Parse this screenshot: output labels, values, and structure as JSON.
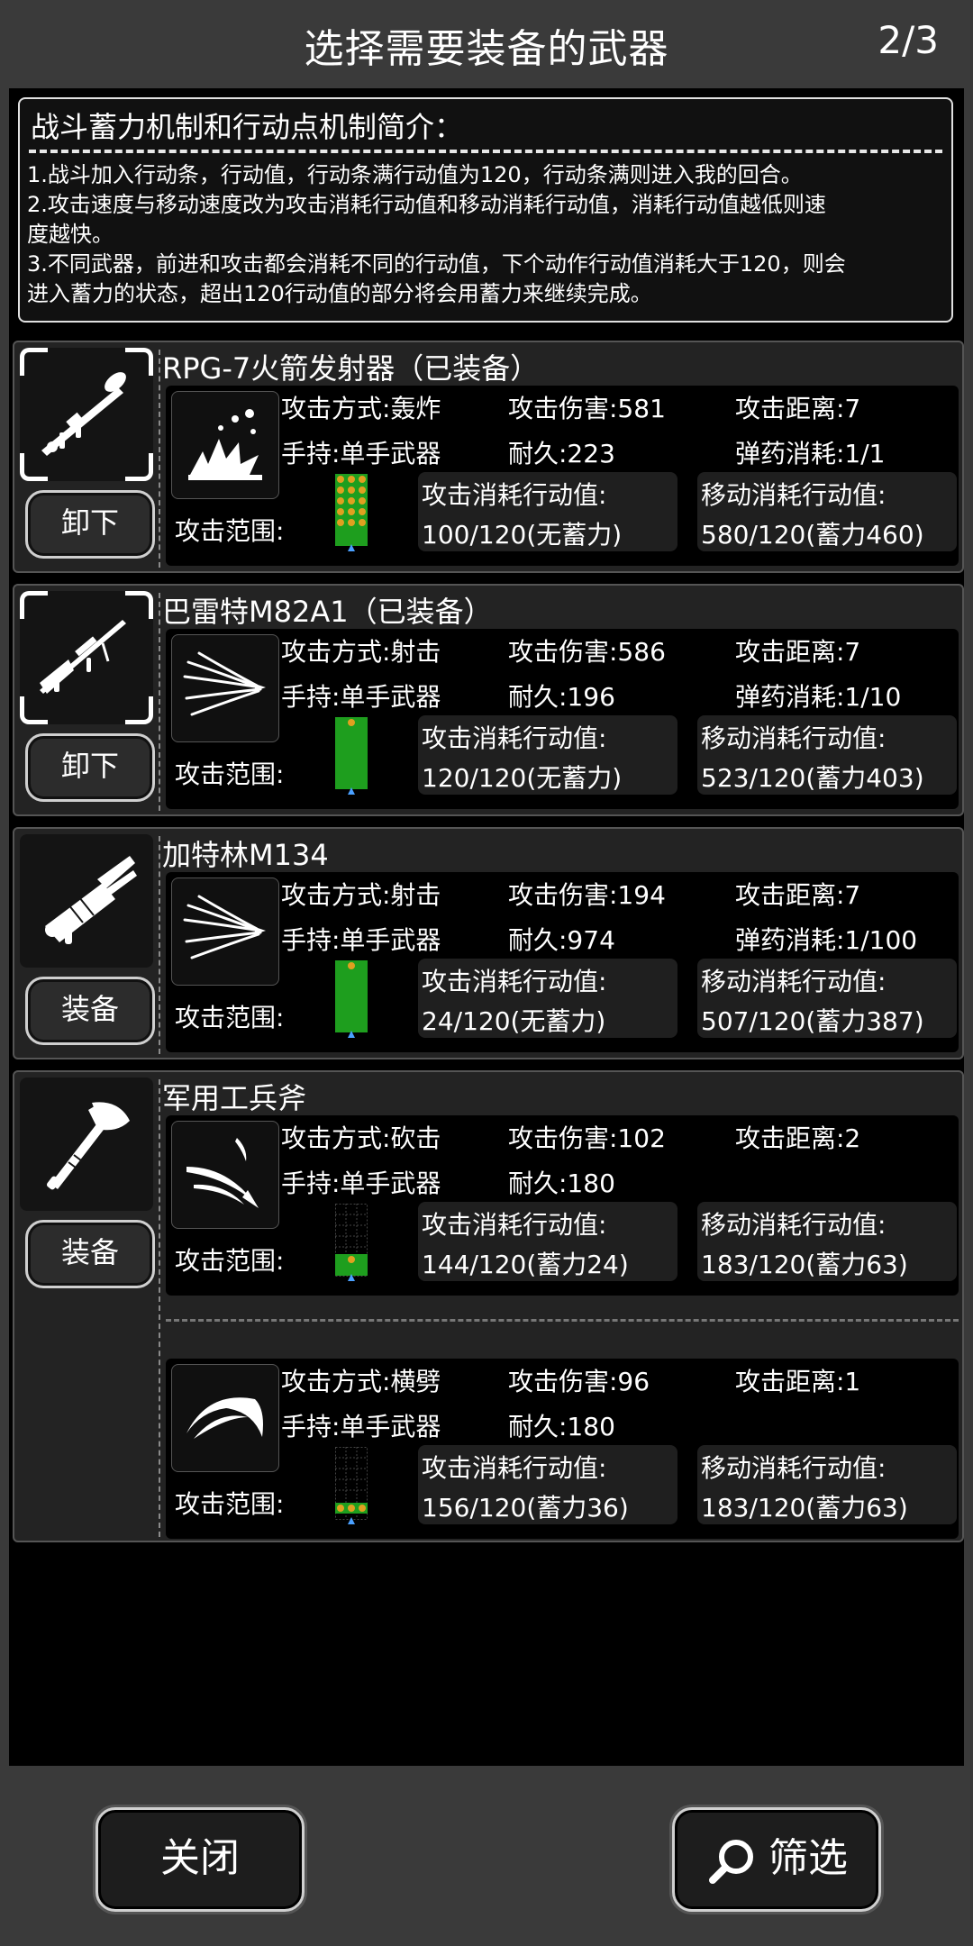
{
  "header": {
    "title": "选择需要装备的武器",
    "page": "2/3"
  },
  "intro": {
    "title": "战斗蓄力机制和行动点机制简介：",
    "lines": [
      "1.战斗加入行动条，行动值，行动条满行动值为120，行动条满则进入我的回合。",
      "2.攻击速度与移动速度改为攻击消耗行动值和移动消耗行动值，消耗行动值越低则速",
      "度越快。",
      "3.不同武器，前进和攻击都会消耗不同的行动值，下个动作行动值消耗大于120，则会",
      "进入蓄力的状态，超出120行动值的部分将会用蓄力来继续完成。"
    ]
  },
  "labels": {
    "range": "攻击范围:",
    "atk_cost": "攻击消耗行动值:",
    "move_cost": "移动消耗行动值:"
  },
  "weapons": [
    {
      "name": "RPG-7火箭发射器（已装备）",
      "button": "卸下",
      "icon": "rocket-launcher-icon",
      "equipped": true,
      "attacks": [
        {
          "icon": "explosion-icon",
          "type": "攻击方式:轰炸",
          "damage": "攻击伤害:581",
          "distance": "攻击距离:7",
          "hold": "手持:单手武器",
          "durability": "耐久:223",
          "ammo": "弹药消耗:1/1",
          "atk_value": "100/120(无蓄力)",
          "move_value": "580/120(蓄力460)"
        }
      ]
    },
    {
      "name": "巴雷特M82A1（已装备）",
      "button": "卸下",
      "icon": "sniper-rifle-icon",
      "equipped": true,
      "attacks": [
        {
          "icon": "shoot-icon",
          "type": "攻击方式:射击",
          "damage": "攻击伤害:586",
          "distance": "攻击距离:7",
          "hold": "手持:单手武器",
          "durability": "耐久:196",
          "ammo": "弹药消耗:1/10",
          "atk_value": "120/120(无蓄力)",
          "move_value": "523/120(蓄力403)"
        }
      ]
    },
    {
      "name": "加特林M134",
      "button": "装备",
      "icon": "gatling-gun-icon",
      "equipped": false,
      "attacks": [
        {
          "icon": "shoot-icon",
          "type": "攻击方式:射击",
          "damage": "攻击伤害:194",
          "distance": "攻击距离:7",
          "hold": "手持:单手武器",
          "durability": "耐久:974",
          "ammo": "弹药消耗:1/100",
          "atk_value": "24/120(无蓄力)",
          "move_value": "507/120(蓄力387)"
        }
      ]
    },
    {
      "name": "军用工兵斧",
      "button": "装备",
      "icon": "axe-icon",
      "equipped": false,
      "attacks": [
        {
          "icon": "chop-icon",
          "type": "攻击方式:砍击",
          "damage": "攻击伤害:102",
          "distance": "攻击距离:2",
          "hold": "手持:单手武器",
          "durability": "耐久:180",
          "ammo": "",
          "atk_value": "144/120(蓄力24)",
          "move_value": "183/120(蓄力63)"
        },
        {
          "icon": "sweep-icon",
          "type": "攻击方式:横劈",
          "damage": "攻击伤害:96",
          "distance": "攻击距离:1",
          "hold": "手持:单手武器",
          "durability": "耐久:180",
          "ammo": "",
          "atk_value": "156/120(蓄力36)",
          "move_value": "183/120(蓄力63)"
        }
      ]
    }
  ],
  "footer": {
    "close": "关闭",
    "filter": "筛选"
  }
}
